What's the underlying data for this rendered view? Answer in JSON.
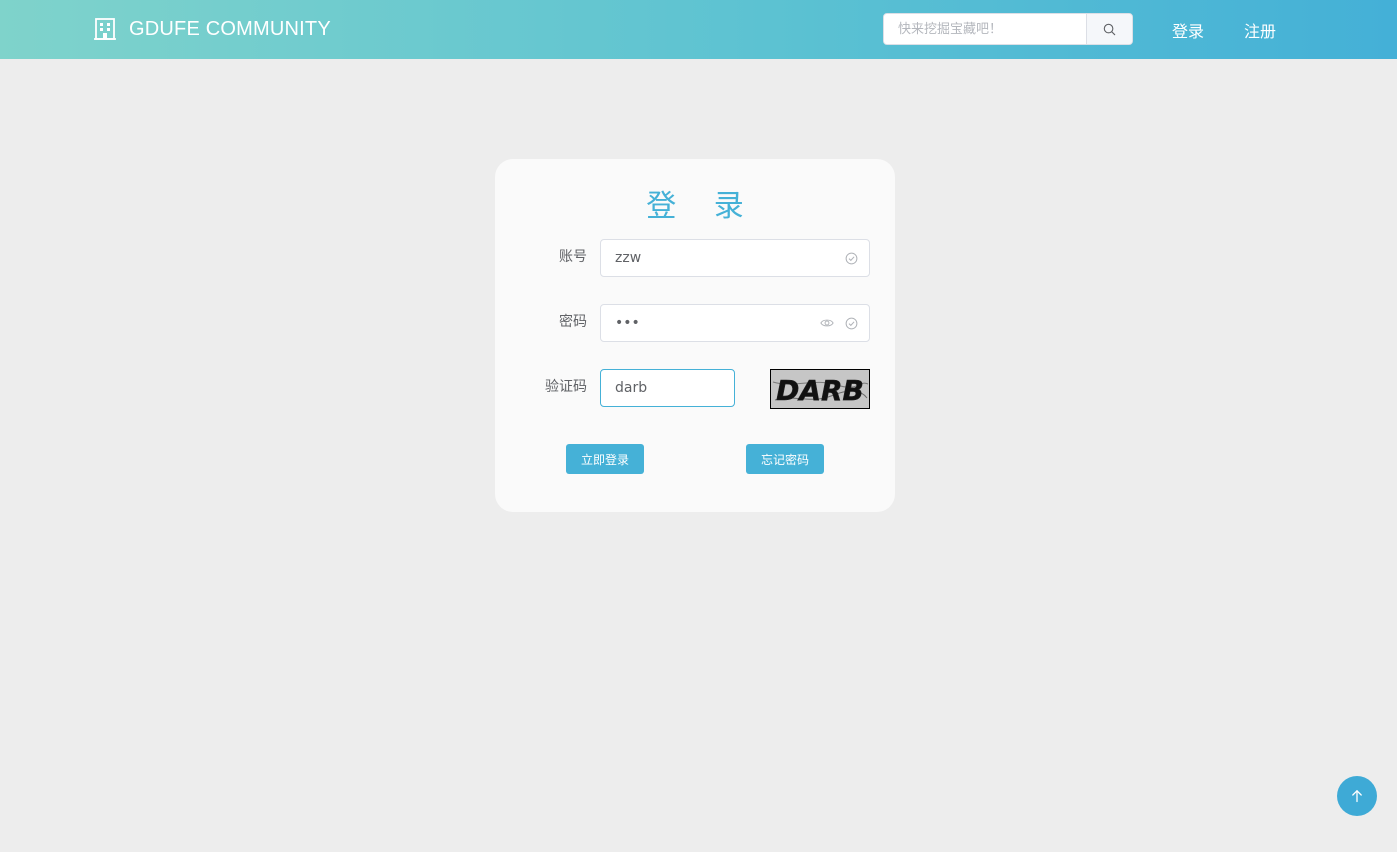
{
  "header": {
    "brand": "GDUFE COMMUNITY",
    "brand_icon": "building-icon",
    "search": {
      "placeholder": "快来挖掘宝藏吧！",
      "value": "",
      "icon": "search-icon"
    },
    "nav": {
      "login": "登录",
      "register": "注册"
    }
  },
  "login_card": {
    "title": "登 录",
    "account": {
      "label": "账号",
      "value": "zzw",
      "status_icon": "check-circle-icon"
    },
    "password": {
      "label": "密码",
      "value": "•••",
      "toggle_icon": "eye-icon",
      "status_icon": "check-circle-icon"
    },
    "captcha": {
      "label": "验证码",
      "value": "darb",
      "image_text": "DARB"
    },
    "buttons": {
      "login": "立即登录",
      "forgot": "忘记密码"
    }
  },
  "back_to_top_icon": "arrow-up-icon",
  "colors": {
    "accent": "#45b1d7",
    "page_bg": "#ededed",
    "header_gradient_start": "#7fd3cb",
    "header_gradient_end": "#44b0d7"
  }
}
